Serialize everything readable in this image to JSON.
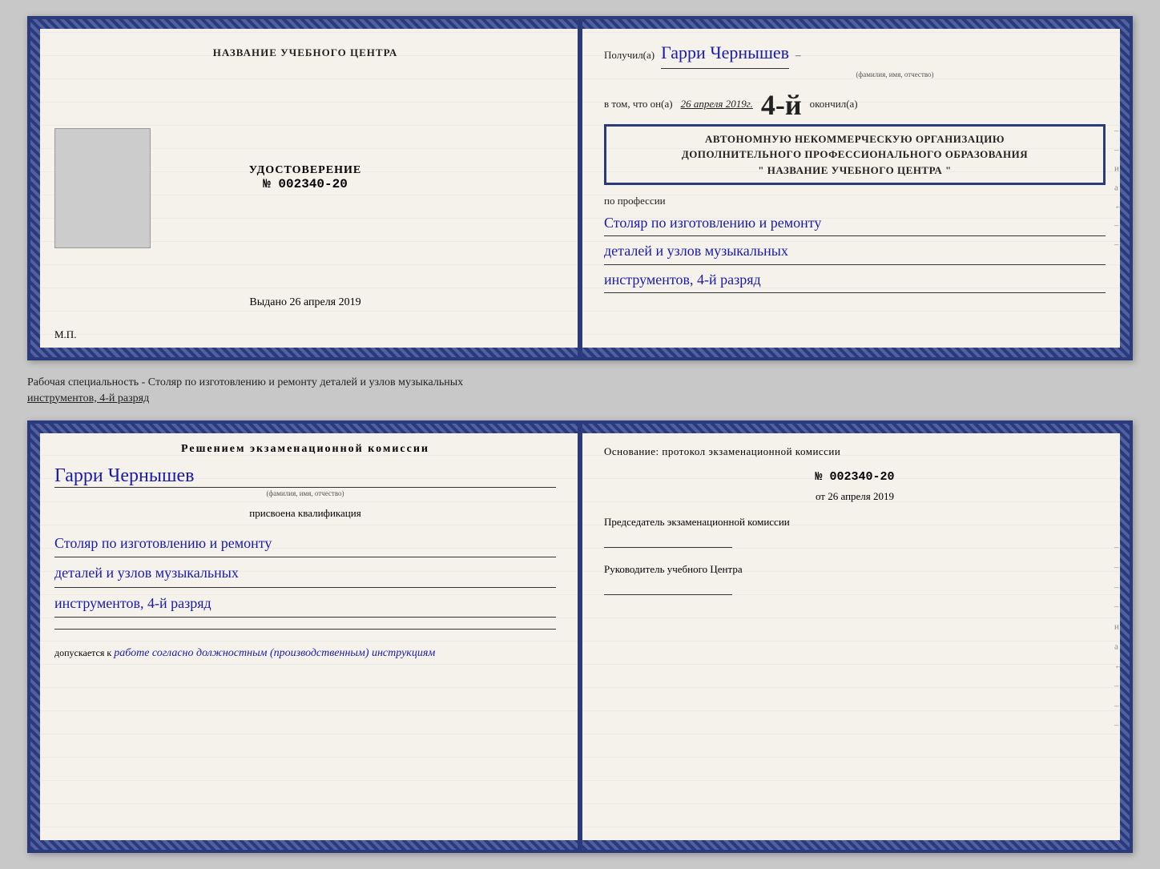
{
  "top_diploma": {
    "left": {
      "center_title": "НАЗВАНИЕ УЧЕБНОГО ЦЕНТРА",
      "udostoverenie_label": "УДОСТОВЕРЕНИЕ",
      "number_prefix": "№",
      "number": "002340-20",
      "vydano_label": "Выдано",
      "vydano_date": "26 апреля 2019",
      "mp_label": "М.П."
    },
    "right": {
      "poluchil_label": "Получил(а)",
      "recipient_name": "Гарри Чернышев",
      "fio_hint": "(фамилия, имя, отчество)",
      "vtom_prefix": "в том, что он(а)",
      "vtom_date": "26 апреля 2019г.",
      "okoncil_label": "окончил(а)",
      "org_line1": "АВТОНОМНУЮ НЕКОММЕРЧЕСКУЮ ОРГАНИЗАЦИЮ",
      "org_line2": "ДОПОЛНИТЕЛЬНОГО ПРОФЕССИОНАЛЬНОГО ОБРАЗОВАНИЯ",
      "org_line3": "\" НАЗВАНИЕ УЧЕБНОГО ЦЕНТРА \"",
      "po_professii_label": "по профессии",
      "profession_line1": "Столяр по изготовлению и ремонту",
      "profession_line2": "деталей и узлов музыкальных",
      "profession_line3": "инструментов, 4-й разряд"
    }
  },
  "description": {
    "text_normal": "Рабочая специальность - Столяр по изготовлению и ремонту деталей и узлов музыкальных",
    "text_underline": "инструментов, 4-й разряд"
  },
  "bottom_diploma": {
    "left": {
      "resheniem_title": "Решением  экзаменационной  комиссии",
      "recipient_name": "Гарри Чернышев",
      "fio_hint": "(фамилия, имя, отчество)",
      "prisvoena_label": "присвоена квалификация",
      "qual_line1": "Столяр по изготовлению и ремонту",
      "qual_line2": "деталей и узлов музыкальных",
      "qual_line3": "инструментов, 4-й разряд",
      "dopuskaetsya_label": "допускается к",
      "dopuskaetsya_value": "работе согласно должностным (производственным) инструкциям"
    },
    "right": {
      "osnovanie_label": "Основание: протокол экзаменационной  комиссии",
      "number_prefix": "№",
      "number": "002340-20",
      "ot_prefix": "от",
      "ot_date": "26 апреля 2019",
      "chairman_label": "Председатель экзаменационной комиссии",
      "rukovoditel_label": "Руководитель учебного Центра"
    }
  },
  "side_decorations": {
    "items": [
      "–",
      "–",
      "и",
      "а",
      "←",
      "–",
      "–",
      "–",
      "–"
    ]
  }
}
